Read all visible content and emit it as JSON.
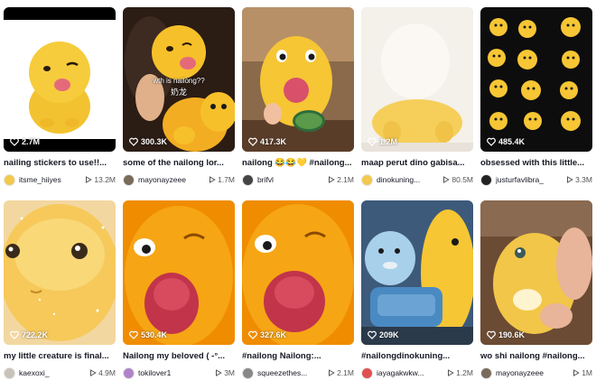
{
  "colors": {
    "card_text": "#161823",
    "muted": "#555555",
    "overlay": "#ffffff"
  },
  "rows": [
    [
      {
        "likes": "2.7M",
        "title": "nailing stickers to use!!...",
        "user": "itsme_hiiyes",
        "plays": "13.2M",
        "avatar_color": "#f2c94c",
        "bg": "#000000",
        "theme": "sticker"
      },
      {
        "likes": "300.3K",
        "title": "some of the nailong lor...",
        "user": "mayonayzeee",
        "plays": "1.7M",
        "avatar_color": "#7a6a5a",
        "bg": "#2b1c14",
        "theme": "selfie",
        "overlay_line1": "wth is nailong??",
        "overlay_line2": "奶龙"
      },
      {
        "likes": "417.3K",
        "title": "nailong 😂😂💛 #nailong...",
        "user": "brifvl",
        "plays": "2.1M",
        "avatar_color": "#444444",
        "bg": "#7a5d43",
        "theme": "watermelon"
      },
      {
        "likes": "1.2M",
        "title": "maap perut dino gabisa...",
        "user": "dinokuning...",
        "plays": "80.5M",
        "avatar_color": "#f2c94c",
        "bg": "#f4f0ea",
        "theme": "belly"
      },
      {
        "likes": "485.4K",
        "title": "obsessed with this little...",
        "user": "justurfavlibra_",
        "plays": "3.3M",
        "avatar_color": "#222222",
        "bg": "#0d0d0d",
        "theme": "grid"
      }
    ],
    [
      {
        "likes": "722.2K",
        "title": "my little creature is final...",
        "user": "kaexoxi_",
        "plays": "4.9M",
        "avatar_color": "#c9c2b8",
        "bg": "#f3d7a0",
        "theme": "closeup"
      },
      {
        "likes": "530.4K",
        "title": "Nailong my beloved ( -°...",
        "user": "tokilover1",
        "plays": "3M",
        "avatar_color": "#b083c9",
        "bg": "#f4a300",
        "theme": "tongue"
      },
      {
        "likes": "327.6K",
        "title": "#nailong Nailong:...",
        "user": "squeezethes...",
        "plays": "2.1M",
        "avatar_color": "#888888",
        "bg": "#f4a300",
        "theme": "tongue2"
      },
      {
        "likes": "209K",
        "title": "#nailongdinokuning...",
        "user": "iayagakwkw...",
        "plays": "1.2M",
        "avatar_color": "#e05050",
        "bg": "#3d5a7a",
        "theme": "toys"
      },
      {
        "likes": "190.6K",
        "title": "wo shi nailong #nailong...",
        "user": "mayonayzeee",
        "plays": "1M",
        "avatar_color": "#7a6a5a",
        "bg": "#6b4b33",
        "theme": "hand"
      }
    ]
  ]
}
